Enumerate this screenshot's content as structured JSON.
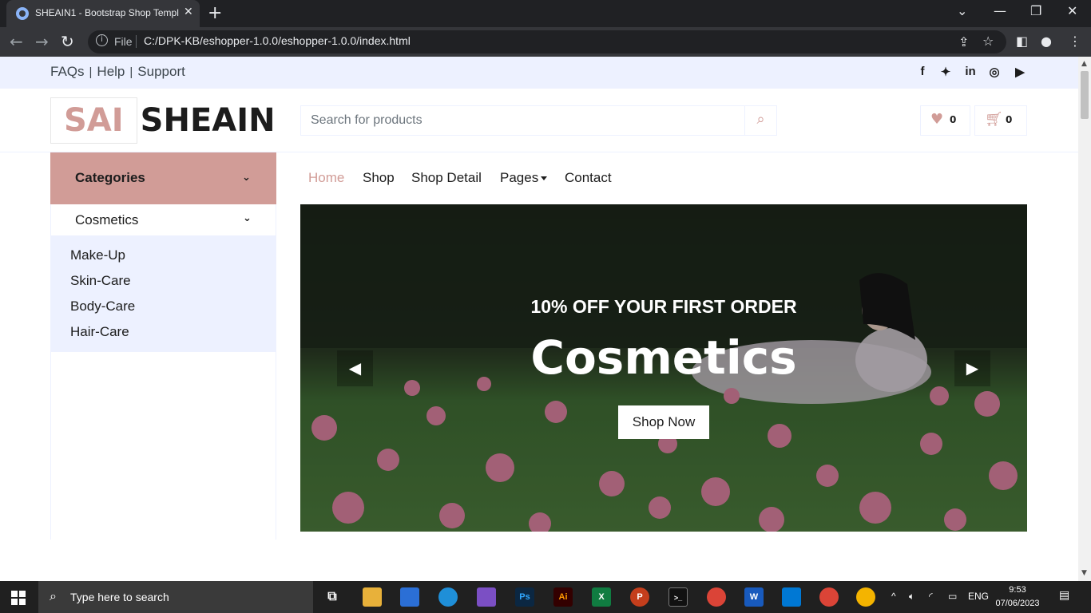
{
  "browser": {
    "tab_title": "SHEAIN1 - Bootstrap Shop Template",
    "file_label": "File",
    "url": "C:/DPK-KB/eshopper-1.0.0/eshopper-1.0.0/index.html"
  },
  "topbar": {
    "links": [
      "FAQs",
      "Help",
      "Support"
    ],
    "social": [
      "facebook-icon",
      "twitter-icon",
      "linkedin-icon",
      "instagram-icon",
      "youtube-icon"
    ]
  },
  "header": {
    "logo_highlight": "SAI",
    "logo_text": "SHEAIN",
    "search_placeholder": "Search for products",
    "wishlist_count": "0",
    "cart_count": "0"
  },
  "sidebar": {
    "categories_label": "Categories",
    "group_label": "Cosmetics",
    "items": [
      "Make-Up",
      "Skin-Care",
      "Body-Care",
      "Hair-Care"
    ]
  },
  "nav": {
    "items": [
      "Home",
      "Shop",
      "Shop Detail",
      "Pages",
      "Contact"
    ],
    "active": "Home"
  },
  "hero": {
    "offer": "10% OFF YOUR FIRST ORDER",
    "title": "Cosmetics",
    "button": "Shop Now"
  },
  "taskbar": {
    "search_text": "Type here to search",
    "language": "ENG",
    "time": "9:53",
    "date": "07/06/2023"
  },
  "colors": {
    "primary": "#d19c97",
    "secondary": "#edf1ff",
    "dark": "#1c1c1c"
  }
}
